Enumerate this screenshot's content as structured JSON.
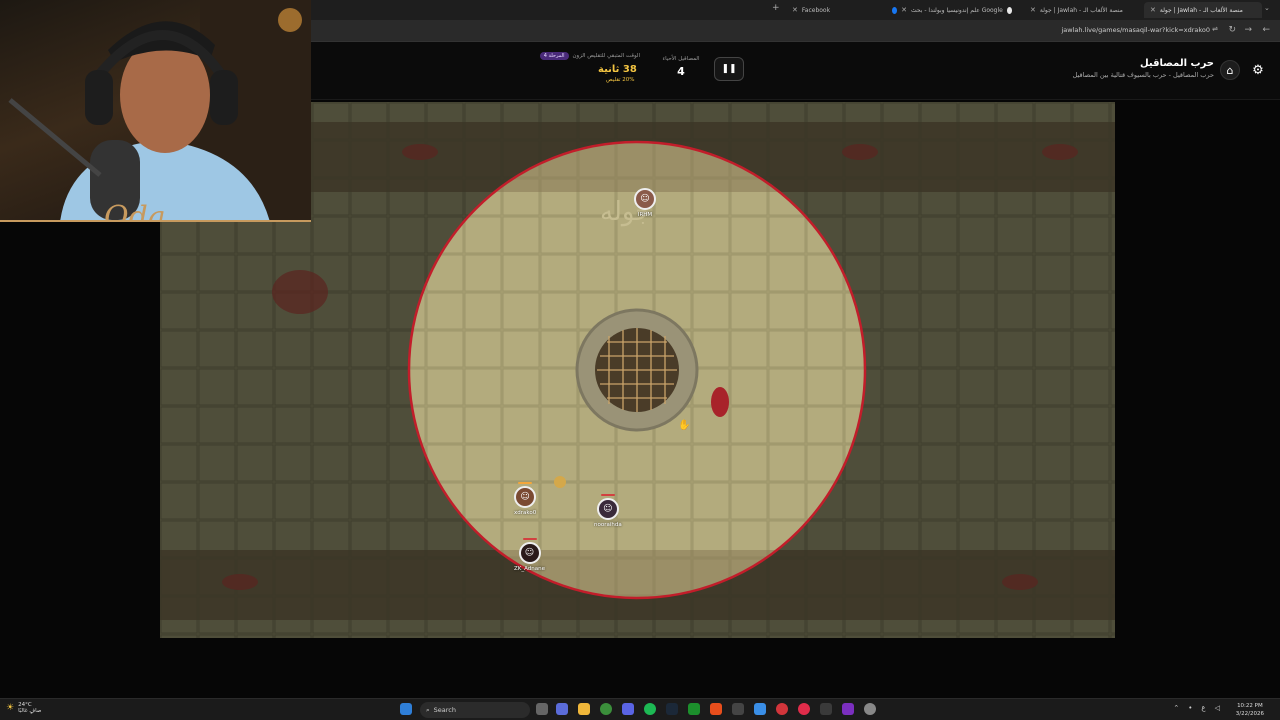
{
  "browser": {
    "tabs": [
      {
        "label": "Facebook",
        "color": "#1877f2"
      },
      {
        "label": "علم إندونيسيا وبولندا - بحث Google",
        "color": "#e8e8e8"
      },
      {
        "label": "جولة | Jawlah - منصة الألعاب الـ",
        "color": "#2a2a2a"
      },
      {
        "label": "جولة | Jawlah - منصة الألعاب الـ",
        "color": "#2a2a2a"
      }
    ],
    "url": "jawlah.live/games/masaqil-war?kick=xdrako0"
  },
  "game_header": {
    "title": "حرب المصاقيل",
    "subtitle": "حرب المصاقيل - حرب بالسيوف قتالية بين المصاقيل",
    "alive_label": "المصاقيل الأحياء",
    "alive_count": "4",
    "timer_label": "الوقت المتبقي للتقليص الزون",
    "stage_badge": "المرحلة 4",
    "timer_value": "38 ثانية",
    "shrink_text": "20% تقليص",
    "pause_icon": "pause-icon",
    "home_icon": "home-icon",
    "settings_icon": "gear-icon"
  },
  "players": [
    {
      "name": "IRHM",
      "color": "#8a5a4a"
    },
    {
      "name": "xdrako0",
      "color": "#7a4a32"
    },
    {
      "name": "nooraihda",
      "color": "#3a2a3a"
    },
    {
      "name": "ZK_Adnane",
      "color": "#2a1a1a"
    }
  ],
  "taskbar": {
    "weather_temp": "24°C",
    "weather_desc": "صافٍ غالبًا",
    "search_placeholder": "Search",
    "time": "10:22 PM",
    "date": "3/22/2026"
  },
  "colors": {
    "arena_floor": "#4b4a37",
    "zone_floor": "#b3ab7d",
    "zone_border": "#c21d2a",
    "timer_accent": "#f4c542",
    "stage_badge": "#4a2a7a"
  }
}
